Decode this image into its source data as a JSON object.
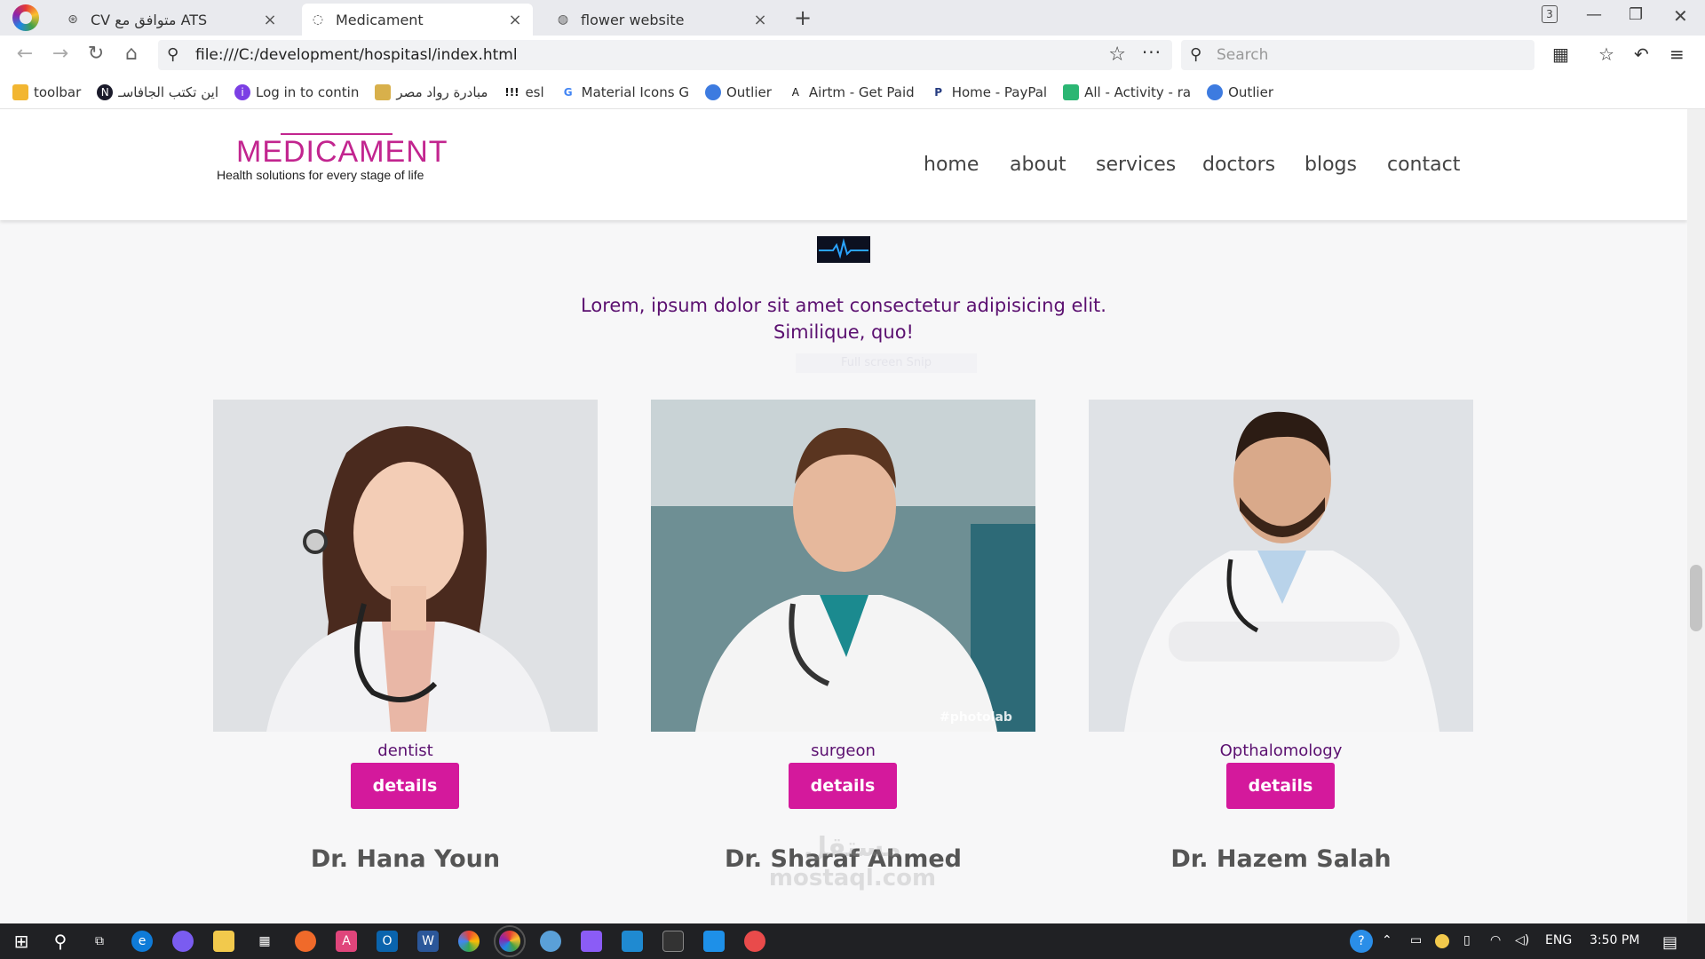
{
  "browser": {
    "tabs": [
      {
        "title": "CV متوافق مع ATS",
        "icon": "openai-icon"
      },
      {
        "title": "Medicament",
        "icon": "loading-icon",
        "active": true
      },
      {
        "title": "flower website",
        "icon": "globe-icon"
      }
    ],
    "tab_counter": "3",
    "address": "file:///C:/development/hospitasl/index.html",
    "search_placeholder": "Search",
    "bookmarks": [
      {
        "label": "toolbar",
        "icon": "folder-icon"
      },
      {
        "label": "اين تكتب الجافاسـ",
        "icon": "n-icon"
      },
      {
        "label": "Log in to contin",
        "icon": "bookmark-icon"
      },
      {
        "label": "مبادرة رواد مصر",
        "icon": "bookmark-icon"
      },
      {
        "label": "esl",
        "icon": "bookmark-icon"
      },
      {
        "label": "Material Icons G",
        "icon": "google-icon"
      },
      {
        "label": "Outlier",
        "icon": "outlier-icon"
      },
      {
        "label": "Airtm - Get Paid",
        "icon": "airtm-icon"
      },
      {
        "label": "Home - PayPal",
        "icon": "paypal-icon"
      },
      {
        "label": "All - Activity - ra",
        "icon": "activity-icon"
      },
      {
        "label": "Outlier",
        "icon": "outlier-icon"
      }
    ]
  },
  "site": {
    "logo_title": "MEDICAMENT",
    "logo_tagline": "Health solutions for every stage of life",
    "nav": [
      "home",
      "about",
      "services",
      "doctors",
      "blogs",
      "contact"
    ],
    "intro_line1": "Lorem, ipsum dolor sit amet consectetur adipisicing elit.",
    "intro_line2": "Similique, quo!",
    "faint_text": "Full screen Snip",
    "doctors": [
      {
        "specialty": "dentist",
        "button": "details",
        "name": "Dr. Hana Youn",
        "photo_bg": "#dfe1e4",
        "coat": "#f2f2f4"
      },
      {
        "specialty": "surgeon",
        "button": "details",
        "name": "Dr. Sharaf Ahmed",
        "photo_bg": "#6e8f94",
        "coat": "#f4f4f4",
        "photo_mark": "#photolab"
      },
      {
        "specialty": "Opthalomology",
        "button": "details",
        "name": "Dr. Hazem Salah",
        "photo_bg": "#dfe2e6",
        "coat": "#f6f6f7"
      }
    ],
    "watermark_line1": "مستقل",
    "watermark_line2": "mostaql.com",
    "accent_color": "#d4199c",
    "text_purple": "#5b1070"
  },
  "taskbar": {
    "language": "ENG",
    "time": "3:50 PM"
  }
}
